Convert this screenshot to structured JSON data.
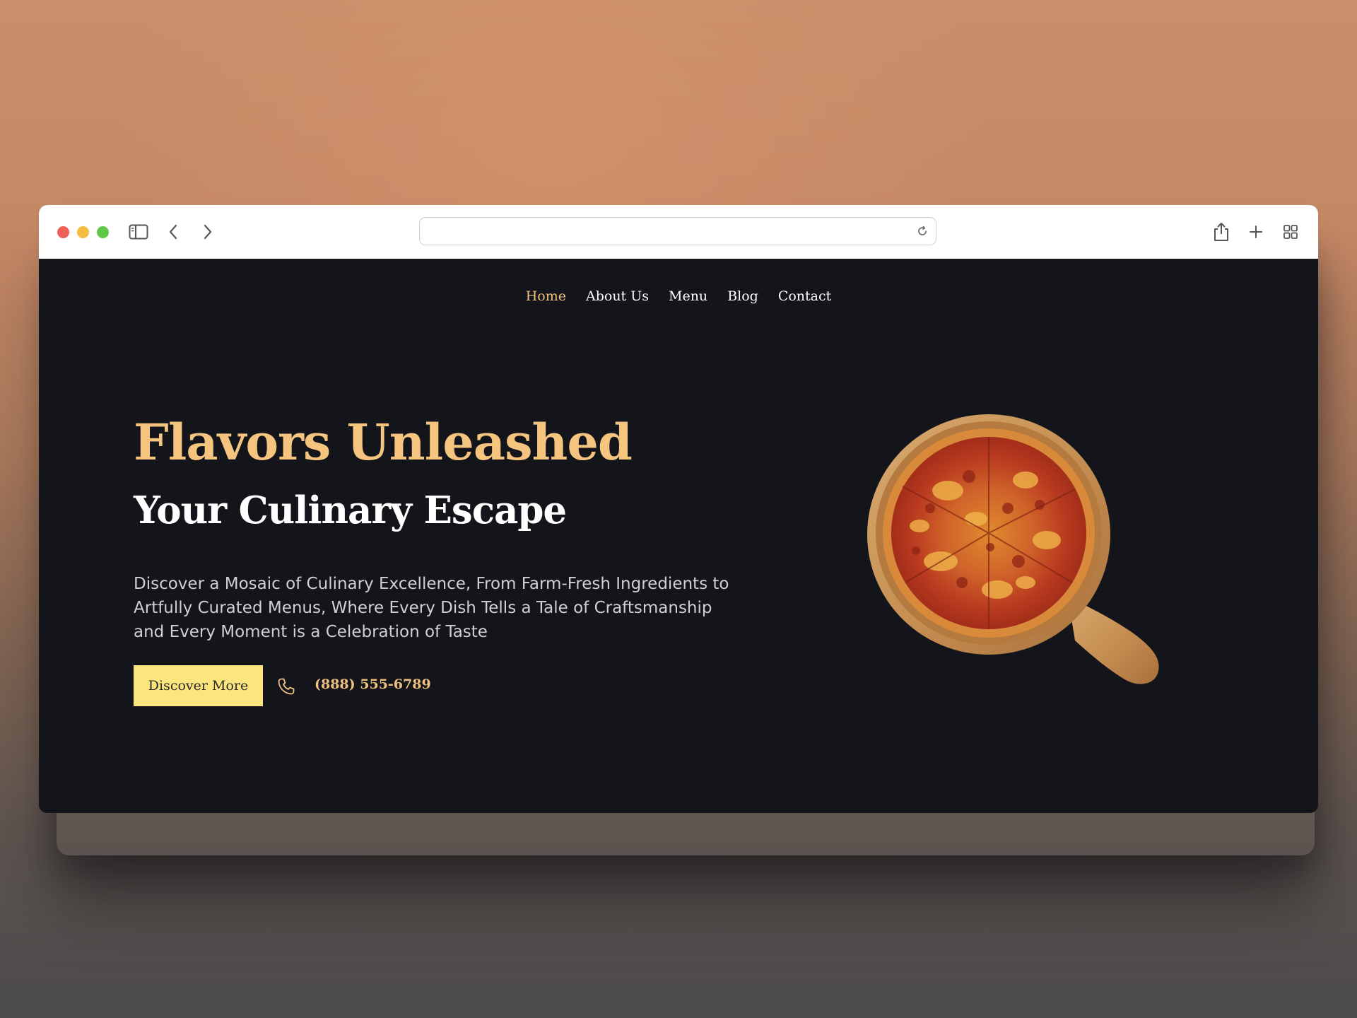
{
  "browser": {
    "url": "",
    "icons": {
      "sidebar": "sidebar-icon",
      "back": "chevron-left-icon",
      "forward": "chevron-right-icon",
      "reload": "reload-icon",
      "share": "share-icon",
      "new_tab": "plus-icon",
      "tab_overview": "grid-icon"
    },
    "traffic_lights": {
      "close": "#ee5f57",
      "minimize": "#f4bc40",
      "zoom": "#5fc648"
    }
  },
  "nav": {
    "items": [
      {
        "label": "Home",
        "active": true
      },
      {
        "label": "About Us",
        "active": false
      },
      {
        "label": "Menu",
        "active": false
      },
      {
        "label": "Blog",
        "active": false
      },
      {
        "label": "Contact",
        "active": false
      }
    ]
  },
  "hero": {
    "title": "Flavors Unleashed",
    "subtitle": "Your Culinary Escape",
    "description": "Discover a Mosaic of Culinary Excellence, From Farm-Fresh Ingredients to Artfully Curated Menus, Where Every Dish Tells a Tale of Craftsmanship and Every Moment is a Celebration of Taste",
    "cta_label": "Discover More",
    "phone": "(888) 555-6789",
    "image": "pizza-on-wooden-board"
  },
  "colors": {
    "page_bg": "#14151b",
    "accent": "#f5c580",
    "button_bg": "#fde57d",
    "text": "#ffffff"
  }
}
